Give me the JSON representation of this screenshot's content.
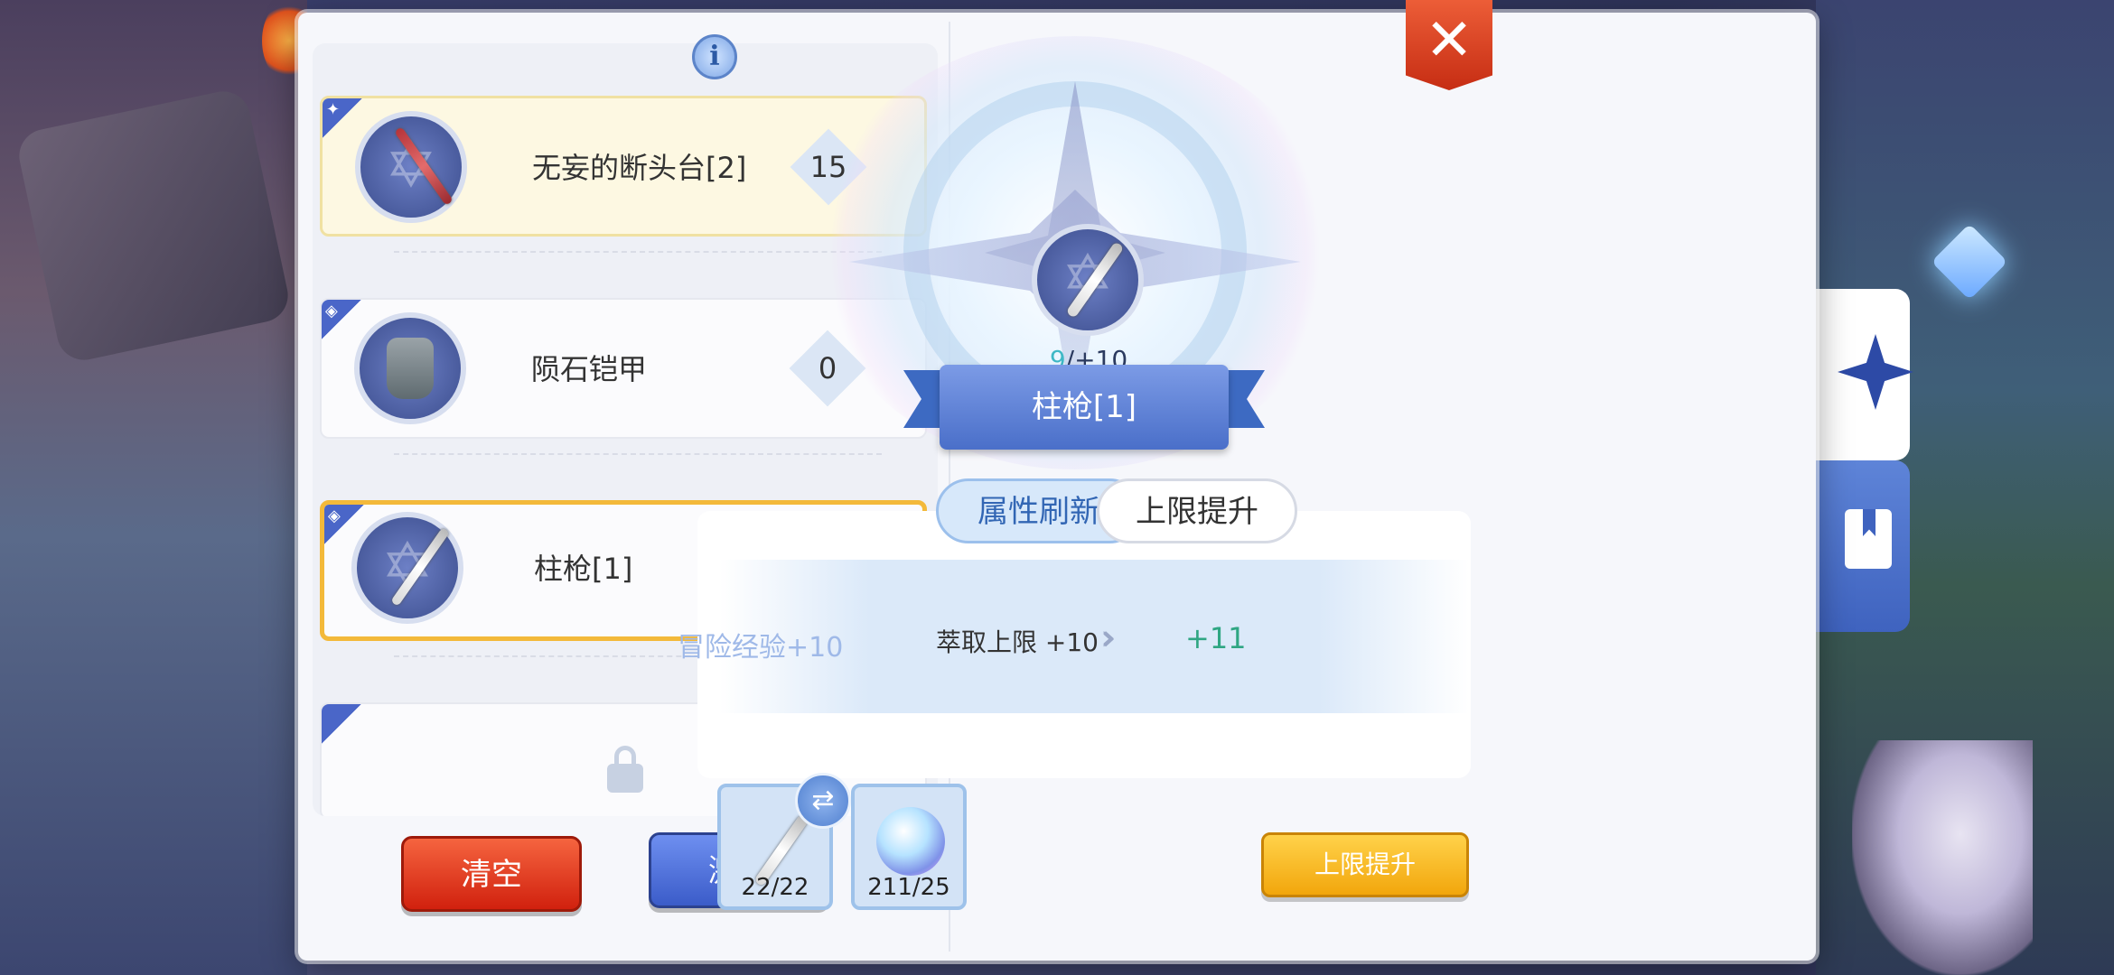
{
  "left_list": {
    "items": [
      {
        "name": "无妄的断头台[2]",
        "level": "15",
        "icon": "axe-icon",
        "category_icon": "sword-category-icon",
        "selected": false
      },
      {
        "name": "陨石铠甲",
        "level": "0",
        "icon": "armor-icon",
        "category_icon": "shield-category-icon",
        "selected": false
      },
      {
        "name": "柱枪[1]",
        "level": "9",
        "icon": "sword-icon",
        "category_icon": "shield-category-icon",
        "selected": true
      },
      {
        "name": "",
        "level": "",
        "icon": "lock-icon",
        "category_icon": "",
        "locked": true
      }
    ]
  },
  "buttons": {
    "clear": "清空",
    "activate": "激活",
    "upgrade": "上限提升"
  },
  "detail": {
    "refine_current": "9",
    "refine_max": "/+10",
    "item_name": "柱枪[1]",
    "tabs": [
      "属性刷新",
      "上限提升"
    ],
    "active_tab": "上限提升",
    "exp_label": "冒险经验+10",
    "limit_label": "萃取上限 +10",
    "limit_new": "+11"
  },
  "materials": [
    {
      "icon": "sword-material-icon",
      "count": "22/22"
    },
    {
      "icon": "crystal-material-icon",
      "count": "211/25"
    }
  ],
  "colors": {
    "selected_border": "#f3b93a",
    "clear_button": "#d1210e",
    "activate_button": "#3b5cc9",
    "upgrade_button": "#f2a60c",
    "new_value": "#2fa683",
    "close_button": "#c62d13"
  }
}
